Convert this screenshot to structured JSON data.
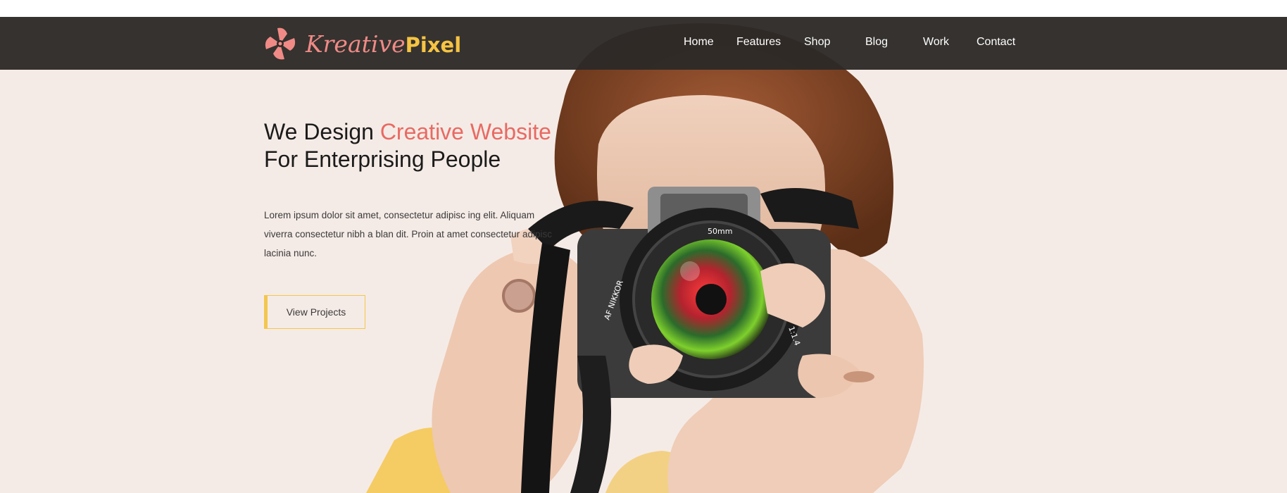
{
  "brand": {
    "part1": "Kreative",
    "part2": "Pixel",
    "color_primary": "#f08a86",
    "color_secondary": "#f6c443"
  },
  "nav": {
    "items": [
      {
        "label": "Home"
      },
      {
        "label": "Features"
      },
      {
        "label": "Shop"
      },
      {
        "label": "Blog"
      },
      {
        "label": "Work"
      },
      {
        "label": "Contact"
      }
    ]
  },
  "hero": {
    "headline_part1": "We Design ",
    "headline_accent": "Creative Website",
    "headline_line2": "For Enterprising People",
    "description": "Lorem ipsum dolor sit amet, consectetur adipisc ing elit. Aliquam viverra consectetur nibh a blan dit. Proin at amet consectetur adipisc lacinia nunc.",
    "cta_label": "View Projects",
    "accent_color": "#e86a63",
    "button_accent_color": "#f3c64e",
    "camera_label": "50mm",
    "lens_brand": "AF NIKKOR",
    "lens_ratio": "1:1.4"
  }
}
